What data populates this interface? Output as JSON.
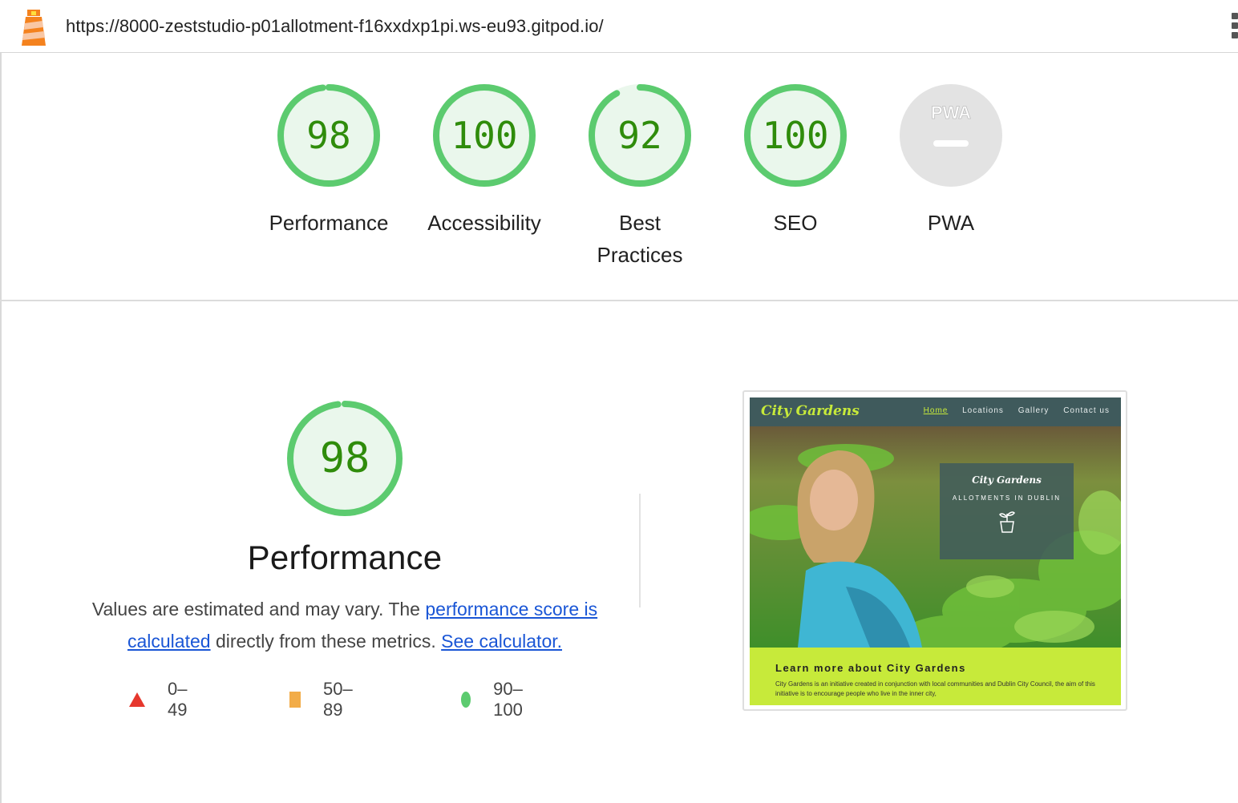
{
  "topbar": {
    "url": "https://8000-zeststudio-p01allotment-f16xxdxp1pi.ws-eu93.gitpod.io/",
    "logo_icon": "lighthouse-icon",
    "menu_icon": "kebab-menu-icon"
  },
  "gauges": [
    {
      "label": "Performance",
      "score": "98",
      "value": 98
    },
    {
      "label": "Accessibility",
      "score": "100",
      "value": 100
    },
    {
      "label": "Best Practices",
      "score": "92",
      "value": 92
    },
    {
      "label": "SEO",
      "score": "100",
      "value": 100
    },
    {
      "label": "PWA",
      "score": "",
      "badge": "PWA"
    }
  ],
  "performance": {
    "score": "98",
    "value": 98,
    "title": "Performance",
    "desc_prefix": "Values are estimated and may vary. The ",
    "link_score": "performance score is calculated",
    "desc_middle": " directly from these metrics. ",
    "link_calculator": "See calculator."
  },
  "legend": [
    {
      "range": "0–49",
      "shape": "triangle",
      "color": "#e6372d"
    },
    {
      "range": "50–89",
      "shape": "square",
      "color": "#f2ac48"
    },
    {
      "range": "90–100",
      "shape": "circle",
      "color": "#5ccb6f"
    }
  ],
  "thumbnail": {
    "brand": "City Gardens",
    "nav": [
      "Home",
      "Locations",
      "Gallery",
      "Contact us"
    ],
    "overlay_brand": "City Gardens",
    "overlay_tagline": "ALLOTMENTS IN DUBLIN",
    "heading": "Learn more about City Gardens",
    "paragraph": "City Gardens is an initiative created in conjunction with local communities and Dublin City Council, the aim of this initiative is to encourage people who live in the inner city,"
  },
  "colors": {
    "pass_green": "#5ccb6f",
    "pass_text": "#2f8c0b",
    "pass_bg": "#eaf7ec",
    "pwa_grey": "#e3e3e3",
    "link_blue": "#1a56d6"
  }
}
